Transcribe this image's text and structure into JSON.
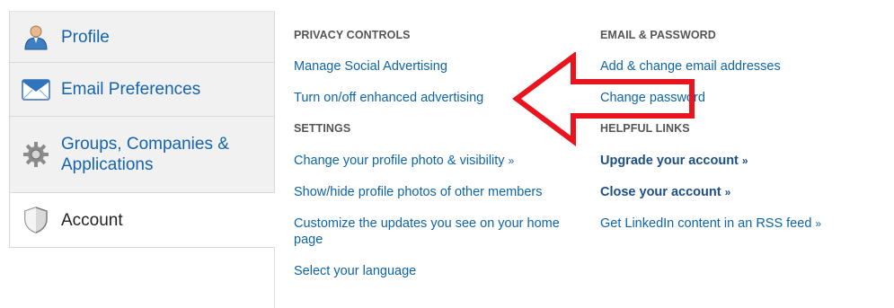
{
  "tabs": [
    {
      "label": "Profile",
      "icon": "profile-person-icon"
    },
    {
      "label": "Email Preferences",
      "icon": "envelope-icon"
    },
    {
      "label": "Groups, Companies & Applications",
      "icon": "gear-icon"
    },
    {
      "label": "Account",
      "icon": "shield-icon",
      "active": true
    }
  ],
  "privacy": {
    "heading": "PRIVACY CONTROLS",
    "links": [
      "Manage Social Advertising",
      "Turn on/off enhanced advertising"
    ]
  },
  "settings": {
    "heading": "SETTINGS",
    "links": [
      "Change your profile photo & visibility",
      "Show/hide profile photos of other members",
      "Customize the updates you see on your home page",
      "Select your language"
    ]
  },
  "email_password": {
    "heading": "EMAIL & PASSWORD",
    "links": [
      "Add & change email addresses",
      "Change password"
    ]
  },
  "helpful": {
    "heading": "HELPFUL LINKS",
    "links": [
      "Upgrade your account",
      "Close your account",
      "Get LinkedIn content in an RSS feed"
    ]
  },
  "raquo": "»",
  "annotation": {
    "icon": "red-arrow-icon",
    "color": "#e8141e"
  },
  "colors": {
    "link": "#0d64a8",
    "heading": "#555555",
    "tab_bg": "#f1f1f1"
  }
}
